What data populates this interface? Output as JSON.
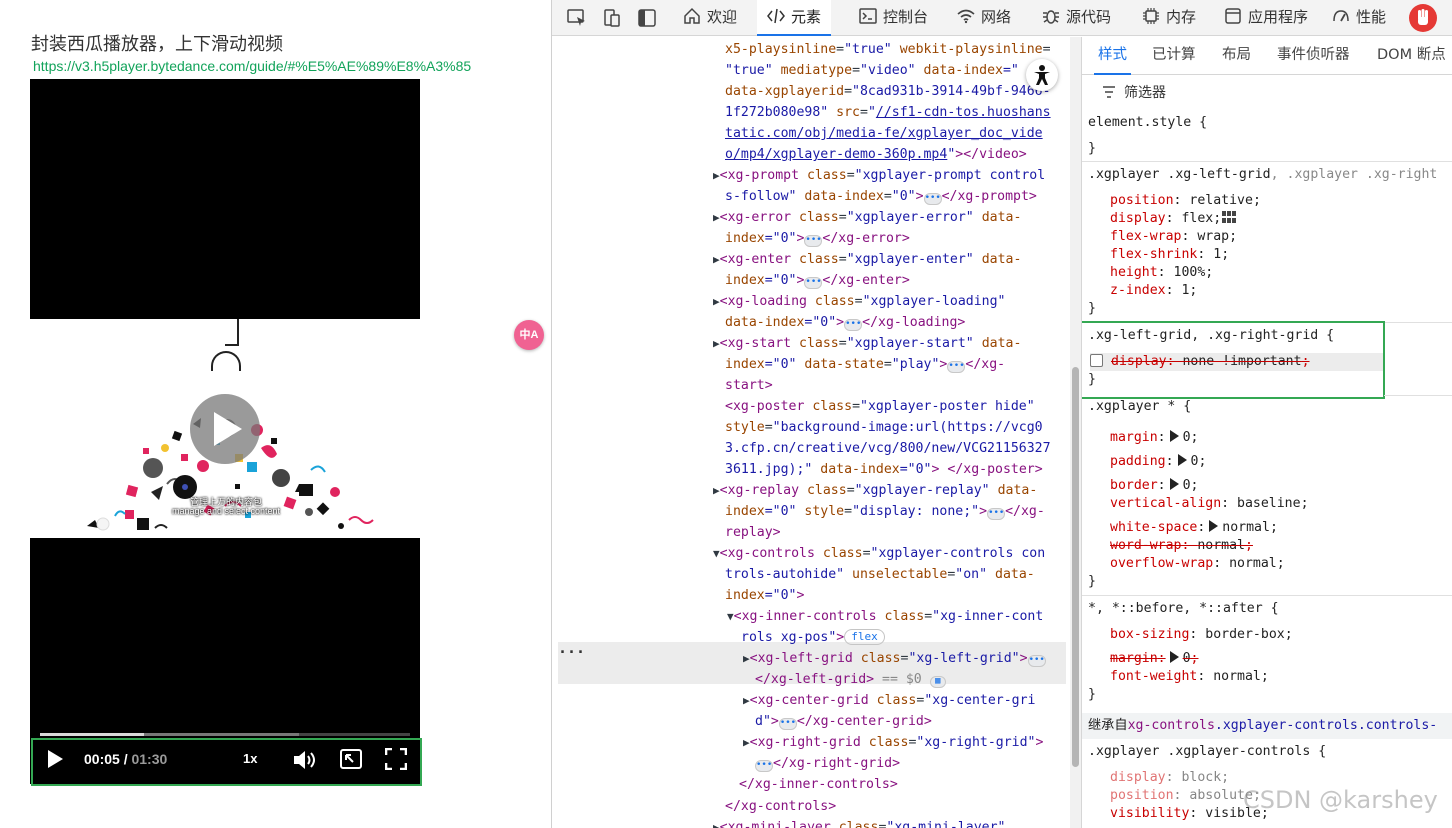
{
  "page": {
    "title": "封装西瓜播放器，上下滑动视频",
    "link": "https://v3.h5player.bytedance.com/guide/#%E5%AE%89%E8%A3%85"
  },
  "player": {
    "time_current": "00:05",
    "time_separator": " / ",
    "time_total": "01:30",
    "rate": "1x",
    "progress_played": 0.28,
    "poster_text_1": "管理上万的内容包",
    "poster_text_2": "manage and select content"
  },
  "translate_badge": "中A",
  "devtools": {
    "tabs": [
      {
        "label": "欢迎",
        "icon": "home-icon"
      },
      {
        "label": "元素",
        "icon": "code-icon"
      },
      {
        "label": "控制台",
        "icon": "console-icon"
      },
      {
        "label": "网络",
        "icon": "wifi-icon"
      },
      {
        "label": "源代码",
        "icon": "bug-icon"
      },
      {
        "label": "内存",
        "icon": "chip-icon"
      },
      {
        "label": "应用程序",
        "icon": "app-icon"
      },
      {
        "label": "性能",
        "icon": "gauge-icon"
      }
    ],
    "styles_tabs": [
      "样式",
      "已计算",
      "布局",
      "事件侦听器",
      "DOM 断点"
    ],
    "filter_label": "筛选器",
    "inherited_prefix": "继承自",
    "inherited_selector": "xg-controls",
    "inherited_class": ".xgplayer-controls.controls-",
    "watermark": "CSDN @karshey",
    "tree": {
      "l1_a": "x5-playsinline",
      "l1_av": "\"true\"",
      "l1_b": "webkit-playsinline",
      "l2_av": "\"true\"",
      "l2_b": "mediatype",
      "l2_bv": "\"video\"",
      "l2_c": "data-index",
      "l2_cv": "=\"",
      "l3_a": "data-xgplayerid",
      "l3_av": "\"8cad931b-3914-49bf-9466-",
      "l4_av": "1f272b080e98\"",
      "l4_b": "src",
      "l4_lnk": "//sf1-cdn-tos.huoshans",
      "l5_lnk": "tatic.com/obj/media-fe/xgplayer_doc_vide",
      "l6_lnk": "o/mp4/xgplayer-demo-360p.mp4",
      "l6_close": "</video>",
      "prompt_tag": "<xg-prompt",
      "prompt_cls": "\"xgplayer-prompt control",
      "prompt_cls2": "s-follow\"",
      "prompt_idx": "\"0\"",
      "prompt_close": "</xg-prompt>",
      "error_tag": "<xg-error",
      "error_cls": "\"xgplayer-error\"",
      "error_close": "</xg-error>",
      "enter_tag": "<xg-enter",
      "enter_cls": "\"xgplayer-enter\"",
      "enter_close": "</xg-enter>",
      "loading_tag": "<xg-loading",
      "loading_cls": "\"xgplayer-loading\"",
      "loading_close": "</xg-loading>",
      "start_tag": "<xg-start",
      "start_cls": "\"xgplayer-start\"",
      "start_state": "\"play\"",
      "start_close": "</xg-",
      "start_close2": "start>",
      "poster_tag": "<xg-poster",
      "poster_cls": "\"xgplayer-poster hide\"",
      "poster_style": "\"background-image:url(https://vcg0",
      "poster_style2": "3.cfp.cn/creative/vcg/800/new/VCG21156327",
      "poster_style3": "3611.jpg);\"",
      "poster_close": "</xg-poster>",
      "replay_tag": "<xg-replay",
      "replay_cls": "\"xgplayer-replay\"",
      "replay_style": "\"display: none;\"",
      "replay_close": "</xg-",
      "replay_close2": "replay>",
      "controls_tag": "<xg-controls",
      "controls_cls": "\"xgplayer-controls con",
      "controls_cls2": "trols-autohide\"",
      "controls_unsel": "\"on\"",
      "controls_idx": "\"0\"",
      "inner_tag": "<xg-inner-controls",
      "inner_cls": "\"xg-inner-cont",
      "inner_cls2": "rols xg-pos\"",
      "flex_pill": "flex",
      "lg_tag": "<xg-left-grid",
      "lg_cls": "\"xg-left-grid\"",
      "lg_close": "</xg-left-grid>",
      "lg_eq": " == $0",
      "cg_tag": "<xg-center-grid",
      "cg_cls": "\"xg-center-gri",
      "cg_cls2": "d\"",
      "cg_close": "</xg-center-grid>",
      "rg_tag": "<xg-right-grid",
      "rg_cls": "\"xg-right-grid\"",
      "rg_close": "</xg-right-grid>",
      "inner_end": "</xg-inner-controls>",
      "controls_end": "</xg-controls>",
      "mini_tag": "<xg-mini-layer",
      "mini_cls": "\"xg-mini-layer\"",
      "attr_class": "class",
      "attr_data_index": "data-",
      "attr_index": "index",
      "attr_data_index_full": "data-index",
      "attr_data_state": "data-state",
      "attr_style": "style",
      "attr_unselectable": "unselectable",
      "eq_zero": "=\"0\"",
      "gt": ">",
      "eq": "=",
      "zero": "\"0\""
    },
    "styles": {
      "element_style": "element.style {",
      "close": "}",
      "r1_sel": ".xgplayer .xg-left-grid",
      "r1_sel2": ", .xgplayer .xg-right",
      "r1_p1": "position",
      "r1_v1": "relative",
      "r1_p2": "display",
      "r1_v2": "flex",
      "r1_p3": "flex-wrap",
      "r1_v3": "wrap",
      "r1_p4": "flex-shrink",
      "r1_v4": "1",
      "r1_p5": "height",
      "r1_v5": "100%",
      "r1_p6": "z-index",
      "r1_v6": "1",
      "r2_sel": ".xg-left-grid, .xg-right-grid {",
      "r2_p1": "display",
      "r2_v1": "none !important",
      "r3_sel": ".xgplayer * {",
      "r3_p1": "margin",
      "r3_v1": "0",
      "r3_p2": "padding",
      "r3_v2": "0",
      "r3_p3": "border",
      "r3_v3": "0",
      "r3_p4": "vertical-align",
      "r3_v4": "baseline",
      "r3_p5": "white-space",
      "r3_v5": "normal",
      "r3_p6": "word-wrap",
      "r3_v6": "normal",
      "r3_p7": "overflow-wrap",
      "r3_v7": "normal",
      "r4_sel": "*, *::before, *::after {",
      "r4_p1": "box-sizing",
      "r4_v1": "border-box",
      "r4_p2": "margin",
      "r4_v2": "0",
      "r4_p3": "font-weight",
      "r4_v3": "normal",
      "r5_sel": ".xgplayer .xgplayer-controls {",
      "r5_p1": "display",
      "r5_v1": "block",
      "r5_p2": "position",
      "r5_v2": "absolute",
      "r5_p3": "visibility",
      "r5_v3": "visible"
    }
  }
}
